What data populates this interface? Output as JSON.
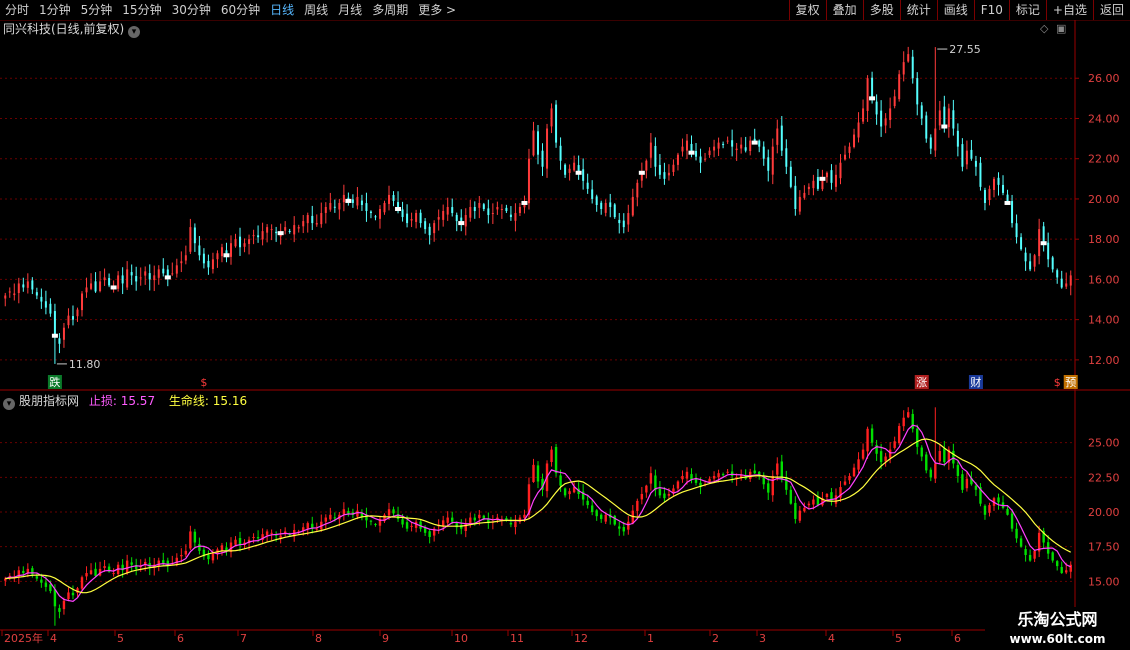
{
  "toolbar": {
    "left": [
      "分时",
      "1分钟",
      "5分钟",
      "15分钟",
      "30分钟",
      "60分钟",
      "日线",
      "周线",
      "月线",
      "多周期",
      "更多 >"
    ],
    "active": "日线",
    "right": [
      "复权",
      "叠加",
      "多股",
      "统计",
      "画线",
      "F10",
      "标记",
      "+自选",
      "返回"
    ]
  },
  "main": {
    "title": "同兴科技(日线,前复权)",
    "y_ticks": [
      "26.00",
      "24.00",
      "22.00",
      "20.00",
      "18.00",
      "16.00",
      "14.00",
      "12.00"
    ],
    "high_label": "27.55",
    "low_label": "11.80",
    "markers": [
      {
        "text": "跌",
        "bg": "#0b7a2a"
      },
      {
        "text": "$",
        "bg": "#000000"
      },
      {
        "text": "涨",
        "bg": "#b02020"
      },
      {
        "text": "财",
        "bg": "#1a3a9a"
      },
      {
        "text": "$",
        "bg": "#000000"
      },
      {
        "text": "预",
        "bg": "#c07000"
      }
    ]
  },
  "indicator": {
    "title": "股朋指标网",
    "stop_label": "止损:",
    "stop_value": "15.57",
    "life_label": "生命线:",
    "life_value": "15.16",
    "y_ticks": [
      "25.00",
      "22.50",
      "20.00",
      "17.50",
      "15.00"
    ]
  },
  "x_axis": [
    "2025年",
    "4",
    "5",
    "6",
    "7",
    "8",
    "9",
    "10",
    "11",
    "12",
    "1",
    "2",
    "3",
    "4",
    "5",
    "6"
  ],
  "watermark": {
    "line1": "乐淘公式网",
    "line2": "www.60lt.com"
  },
  "colors": {
    "up": "#ff3b3b",
    "down": "#54ffff",
    "ind_up": "#ff2020",
    "ind_down": "#00e000",
    "life_line": "#ffff40",
    "stop_line": "#ff40ff",
    "grid": "#6a0000",
    "axis": "#9a0000"
  },
  "chart_data": {
    "type": "candlestick",
    "ylim_main": [
      11,
      28
    ],
    "ylim_indicator": [
      13.8,
      27.5
    ],
    "close": [
      15.2,
      15.4,
      15.3,
      15.8,
      15.6,
      15.9,
      15.5,
      15.2,
      14.9,
      14.6,
      14.3,
      13.2,
      12.8,
      13.6,
      14.2,
      14.0,
      14.5,
      15.3,
      15.6,
      15.8,
      15.4,
      15.9,
      16.1,
      15.7,
      15.6,
      16.2,
      15.8,
      16.5,
      16.2,
      15.9,
      16.1,
      16.4,
      16.0,
      16.2,
      16.5,
      16.3,
      16.1,
      16.3,
      16.7,
      16.9,
      17.2,
      18.6,
      17.8,
      17.2,
      16.8,
      16.6,
      17.0,
      17.3,
      17.6,
      17.2,
      17.8,
      18.0,
      17.6,
      17.8,
      18.0,
      18.2,
      18.1,
      18.4,
      18.6,
      18.5,
      18.3,
      18.3,
      18.6,
      18.4,
      18.7,
      18.6,
      18.9,
      19.2,
      18.8,
      18.8,
      19.3,
      19.6,
      19.8,
      19.6,
      19.8,
      20.2,
      19.9,
      19.8,
      20.1,
      19.7,
      19.4,
      19.3,
      19.1,
      19.5,
      19.8,
      20.2,
      19.9,
      19.5,
      19.1,
      18.8,
      19.0,
      19.3,
      18.8,
      18.5,
      18.2,
      18.8,
      19.1,
      19.4,
      19.6,
      19.3,
      18.9,
      18.8,
      19.2,
      19.6,
      19.4,
      19.8,
      19.5,
      19.2,
      19.3,
      19.6,
      19.5,
      19.4,
      19.1,
      19.3,
      19.6,
      19.8,
      22.0,
      23.4,
      22.2,
      21.6,
      23.5,
      24.5,
      22.8,
      21.9,
      21.2,
      21.5,
      21.8,
      21.3,
      20.9,
      20.5,
      20.0,
      19.7,
      19.5,
      19.8,
      19.6,
      19.1,
      18.8,
      18.6,
      19.3,
      20.1,
      20.8,
      21.3,
      21.9,
      22.8,
      21.6,
      21.2,
      21.0,
      21.3,
      21.7,
      22.2,
      22.6,
      22.9,
      22.3,
      22.1,
      21.8,
      22.0,
      22.4,
      22.6,
      22.8,
      22.7,
      22.9,
      22.6,
      22.5,
      22.7,
      22.4,
      22.9,
      22.8,
      22.6,
      22.0,
      21.4,
      22.6,
      23.5,
      22.4,
      21.6,
      20.6,
      19.5,
      20.1,
      20.3,
      20.6,
      20.9,
      20.5,
      21.0,
      21.3,
      20.8,
      21.2,
      21.8,
      22.2,
      22.6,
      23.2,
      23.8,
      24.5,
      26.0,
      25.0,
      24.2,
      23.6,
      24.0,
      24.5,
      25.1,
      26.2,
      26.8,
      27.2,
      26.0,
      24.7,
      24.0,
      23.0,
      22.5,
      23.5,
      24.4,
      23.6,
      24.5,
      23.5,
      22.6,
      21.6,
      22.4,
      22.0,
      21.6,
      20.6,
      19.8,
      20.5,
      21.0,
      20.7,
      20.3,
      19.8,
      18.8,
      18.1,
      17.5,
      16.9,
      16.5,
      17.2,
      18.5,
      17.8,
      17.0,
      16.5,
      16.1,
      15.6,
      15.8,
      16.2
    ]
  }
}
